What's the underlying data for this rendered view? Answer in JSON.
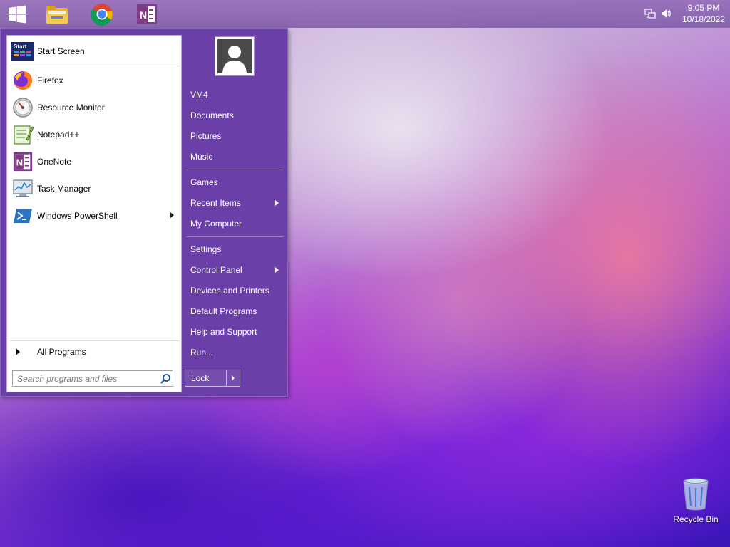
{
  "taskbar": {
    "pinned": [
      {
        "name": "start",
        "icon": "windows-logo-icon"
      },
      {
        "name": "file-explorer",
        "icon": "folder-icon"
      },
      {
        "name": "chrome",
        "icon": "chrome-icon"
      },
      {
        "name": "onenote",
        "icon": "onenote-icon"
      }
    ],
    "clock": {
      "time": "9:05 PM",
      "date": "10/18/2022"
    },
    "tray_icons": [
      "network-icon",
      "volume-icon"
    ]
  },
  "start_menu": {
    "programs": [
      {
        "label": "Start Screen",
        "icon": "start-screen-icon",
        "has_submenu": false
      },
      {
        "label": "Firefox",
        "icon": "firefox-icon",
        "has_submenu": false
      },
      {
        "label": "Resource Monitor",
        "icon": "resource-monitor-icon",
        "has_submenu": false
      },
      {
        "label": "Notepad++",
        "icon": "notepad-plus-plus-icon",
        "has_submenu": false
      },
      {
        "label": "OneNote",
        "icon": "onenote-icon",
        "has_submenu": false
      },
      {
        "label": "Task Manager",
        "icon": "task-manager-icon",
        "has_submenu": false
      },
      {
        "label": "Windows PowerShell",
        "icon": "powershell-icon",
        "has_submenu": true
      }
    ],
    "start_screen_badge": "Start",
    "all_programs_label": "All Programs",
    "search_placeholder": "Search programs and files",
    "user_avatar_icon": "user-avatar-icon",
    "right_items": [
      {
        "label": "VM4",
        "has_submenu": false
      },
      {
        "label": "Documents",
        "has_submenu": false
      },
      {
        "label": "Pictures",
        "has_submenu": false
      },
      {
        "label": "Music",
        "has_submenu": false
      },
      {
        "label": "Games",
        "has_submenu": false
      },
      {
        "label": "Recent Items",
        "has_submenu": true
      },
      {
        "label": "My Computer",
        "has_submenu": false
      },
      {
        "label": "Settings",
        "has_submenu": false
      },
      {
        "label": "Control Panel",
        "has_submenu": true
      },
      {
        "label": "Devices and Printers",
        "has_submenu": false
      },
      {
        "label": "Default Programs",
        "has_submenu": false
      },
      {
        "label": "Help and Support",
        "has_submenu": false
      },
      {
        "label": "Run...",
        "has_submenu": false
      }
    ],
    "lock_label": "Lock"
  },
  "desktop": {
    "icons": [
      {
        "label": "Recycle Bin",
        "icon": "recycle-bin-icon"
      }
    ]
  },
  "colors": {
    "start_menu_bg": "#6b3fa8",
    "taskbar_bg": "#8a62b0",
    "wallpaper_primary": "#5a1fd0"
  }
}
